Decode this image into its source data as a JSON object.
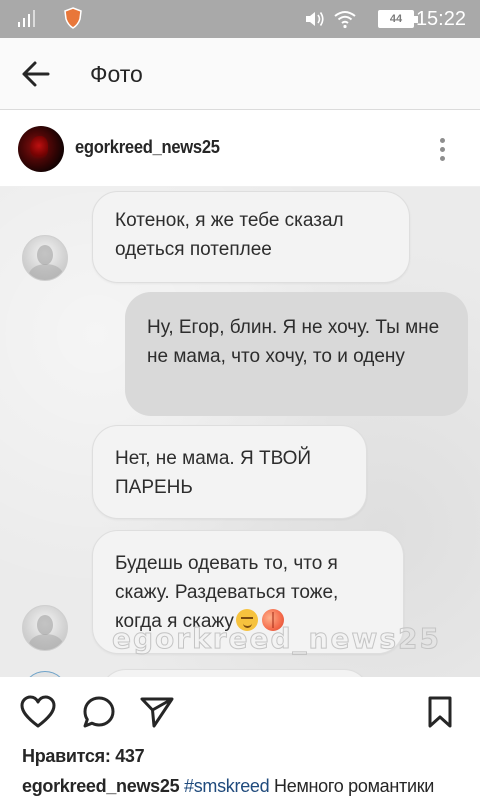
{
  "status_bar": {
    "time": "15:22",
    "battery": "44"
  },
  "toolbar": {
    "title": "Фото"
  },
  "post": {
    "username": "egorkreed_news25",
    "messages": [
      "Котенок, я же тебе сказал одеться потеплее",
      "Ну, Егор, блин. Я не хочу. Ты мне не мама, что хочу, то и одену",
      "Нет, не мама. Я ТВОЙ ПАРЕНЬ",
      "Будешь одевать то, что я скажу. Раздеваться тоже, когда я скажу"
    ],
    "watermark": "egorkreed_news25",
    "likes": "Нравится: 437",
    "caption_user": "egorkreed_news25",
    "caption_tag": "#smskreed",
    "caption_text": "Немного романтики"
  },
  "icons": {
    "back": "arrow-left-icon",
    "more": "more-vertical-icon",
    "like": "heart-icon",
    "comment": "comment-icon",
    "share": "send-icon",
    "save": "bookmark-icon"
  }
}
